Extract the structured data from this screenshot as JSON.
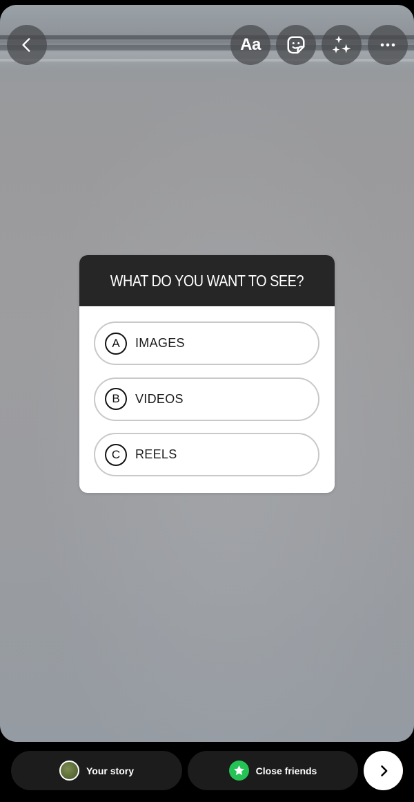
{
  "toolbar": {
    "back_icon": "chevron-left-icon",
    "text_tool_label": "Aa",
    "sticker_icon": "sticker-icon",
    "effects_icon": "sparkles-icon",
    "more_icon": "more-horizontal-icon"
  },
  "quiz_sticker": {
    "question": "WHAT DO YOU WANT TO SEE?",
    "options": [
      {
        "letter": "A",
        "text": "IMAGES"
      },
      {
        "letter": "B",
        "text": "VIDEOS"
      },
      {
        "letter": "C",
        "text": "REELS"
      }
    ]
  },
  "share_bar": {
    "your_story_label": "Your story",
    "close_friends_label": "Close friends",
    "close_friends_color": "#25c356",
    "next_icon": "chevron-right-icon"
  }
}
